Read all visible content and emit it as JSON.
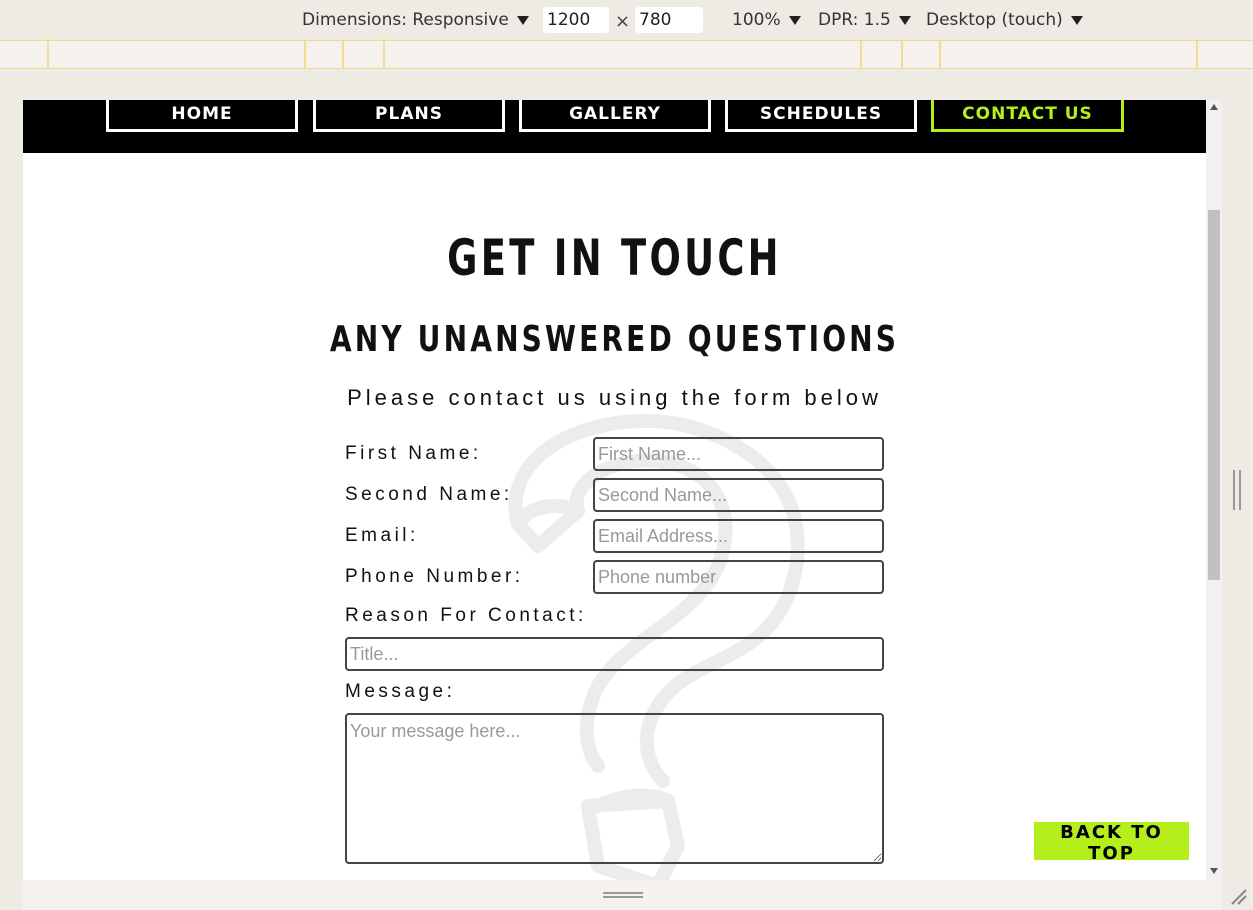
{
  "devtools": {
    "dimensions_label": "Dimensions: Responsive",
    "width": "1200",
    "height": "780",
    "times": "×",
    "zoom": "100%",
    "dpr": "DPR: 1.5",
    "device_mode": "Desktop (touch)"
  },
  "nav": {
    "items": [
      {
        "label": "HOME"
      },
      {
        "label": "PLANS"
      },
      {
        "label": "GALLERY"
      },
      {
        "label": "SCHEDULES"
      },
      {
        "label": "CONTACT US"
      }
    ],
    "active": "CONTACT US",
    "accent_color": "#b4ef1c"
  },
  "page": {
    "title": "GET IN TOUCH",
    "subtitle": "ANY UNANSWERED QUESTIONS",
    "intro": "Please contact us using the form below"
  },
  "form": {
    "first_name": {
      "label": "First Name:",
      "placeholder": "First Name..."
    },
    "second_name": {
      "label": "Second Name:",
      "placeholder": "Second Name..."
    },
    "email": {
      "label": "Email:",
      "placeholder": "Email Address..."
    },
    "phone": {
      "label": "Phone Number:",
      "placeholder": "Phone number"
    },
    "reason": {
      "label": "Reason For Contact:",
      "placeholder": "Title..."
    },
    "message": {
      "label": "Message:",
      "placeholder": "Your message here..."
    }
  },
  "back_to_top": "BACK TO TOP",
  "icons": {
    "watermark": "question-mark-icon"
  }
}
